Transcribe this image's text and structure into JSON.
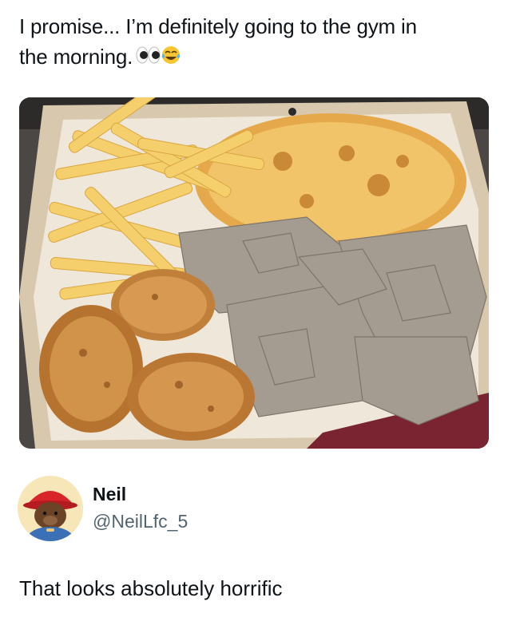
{
  "post": {
    "caption_line1": "I promise... I’m definitely going to the gym in",
    "caption_line2": "the morning.",
    "caption_emojis": [
      "eyes-emoji",
      "tears-of-joy-emoji"
    ],
    "image_description_icon": "photo-image"
  },
  "author": {
    "name": "Neil",
    "handle": "@NeilLfc_5",
    "avatar_icon": "bear-with-red-hat-avatar"
  },
  "reply": {
    "text": "That looks absolutely horrific"
  }
}
